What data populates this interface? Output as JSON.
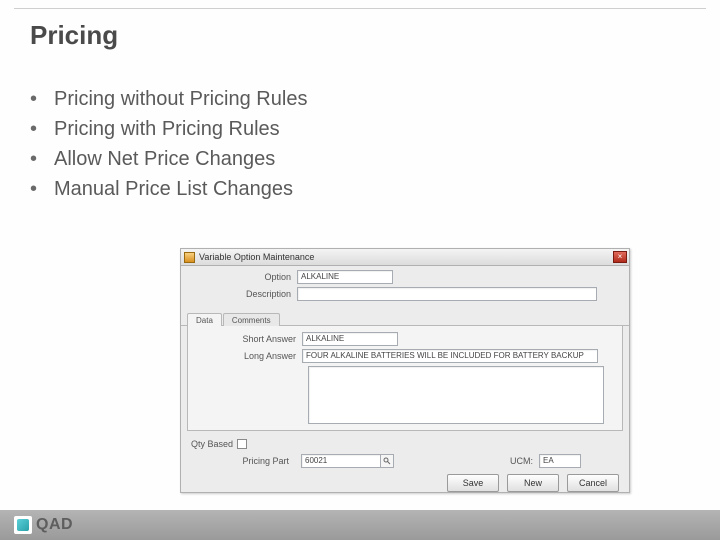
{
  "title": "Pricing",
  "bullets": [
    "Pricing without Pricing Rules",
    "Pricing with Pricing Rules",
    "Allow Net Price Changes",
    "Manual Price List Changes"
  ],
  "dialog": {
    "window_title": "Variable Option Maintenance",
    "close_label": "×",
    "labels": {
      "option": "Option",
      "description": "Description",
      "short_answer": "Short Answer",
      "long_answer": "Long Answer",
      "qty_based": "Qty Based",
      "pricing_part": "Pricing Part",
      "ucm": "UCM:"
    },
    "fields": {
      "option": "ALKALINE",
      "description": "",
      "short_answer": "ALKALINE",
      "long_answer": "FOUR ALKALINE BATTERIES WILL BE INCLUDED FOR BATTERY BACKUP",
      "pricing_part": "60021",
      "ucm": "EA"
    },
    "tabs": {
      "data": "Data",
      "comments": "Comments"
    },
    "buttons": {
      "save": "Save",
      "new": "New",
      "cancel": "Cancel"
    }
  },
  "footer": {
    "brand": "QAD"
  }
}
